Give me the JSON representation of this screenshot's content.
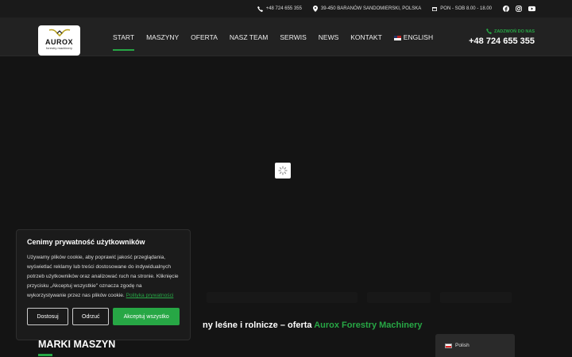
{
  "topbar": {
    "phone": "+48 724 655 355",
    "address": "39-450 BARANÓW SANDOMIERSKI, POLSKA",
    "hours": "PON - SOB 8.00 - 18.00",
    "socials": [
      "facebook-icon",
      "instagram-icon",
      "youtube-icon"
    ]
  },
  "logo": {
    "brand": "AUROX",
    "tagline": "forestry machinery"
  },
  "nav": {
    "items": [
      {
        "label": "START",
        "active": true
      },
      {
        "label": "MASZYNY"
      },
      {
        "label": "OFERTA"
      },
      {
        "label": "NASZ TEAM"
      },
      {
        "label": "SERWIS"
      },
      {
        "label": "NEWS"
      },
      {
        "label": "KONTAKT"
      },
      {
        "label": "ENGLISH"
      }
    ]
  },
  "call": {
    "label": "ZADZWOŃ DO NAS",
    "phone": "+48 724 655 355"
  },
  "content": {
    "headline_prefix": "ny leśne i rolnicze – oferta ",
    "headline_brand": "Aurox Forestry Machinery",
    "brands_title": "MARKI MASZYN"
  },
  "cookie": {
    "title": "Cenimy prywatność użytkowników",
    "text": "Używamy plików cookie, aby poprawić jakość przeglądania, wyświetlać reklamy lub treści dostosowane do indywidualnych potrzeb użytkowników oraz analizować ruch na stronie. Kliknięcie przycisku „Akceptuj wszystkie\" oznacza zgodę na wykorzystywanie przez nas plików cookie.",
    "link": "Polityka prywatności",
    "buttons": {
      "customize": "Dostosuj",
      "reject": "Odrzuć",
      "accept": "Akceptuj wszystko"
    }
  },
  "language_switcher": {
    "current": "Polish"
  },
  "colors": {
    "accent": "#27a745",
    "background": "#141414",
    "header": "#222222"
  }
}
